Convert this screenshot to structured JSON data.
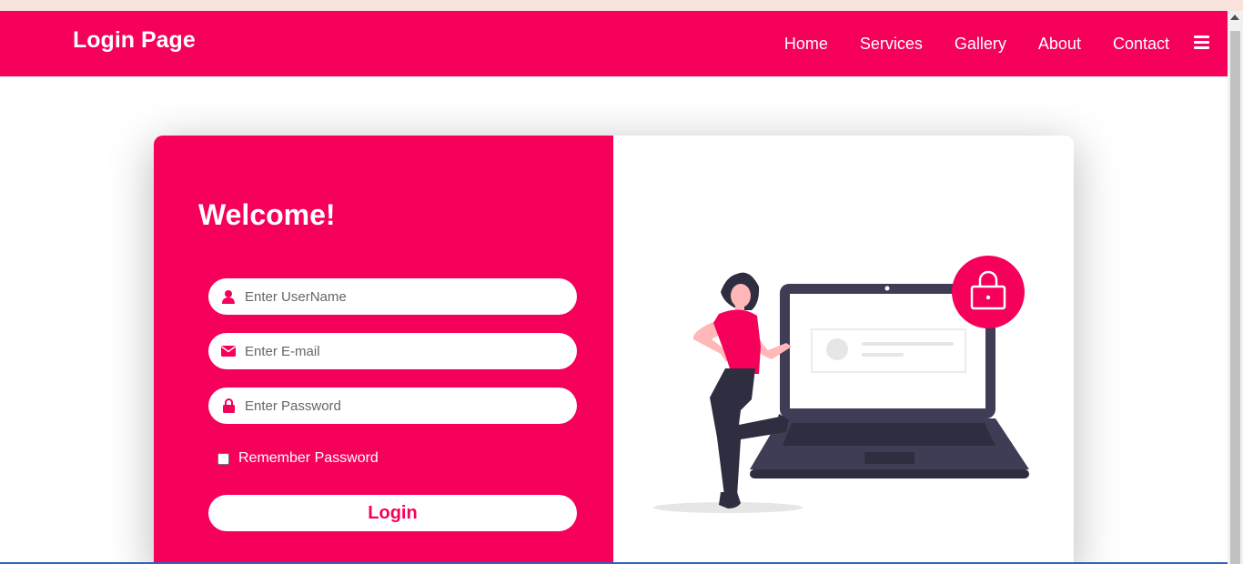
{
  "navbar": {
    "brand": "Login Page",
    "links": [
      "Home",
      "Services",
      "Gallery",
      "About",
      "Contact"
    ],
    "menu_icon": "hamburger-menu-icon"
  },
  "login": {
    "welcome": "Welcome!",
    "username_placeholder": "Enter UserName",
    "email_placeholder": "Enter E-mail",
    "password_placeholder": "Enter Password",
    "remember_label": "Remember Password",
    "remember_checked": false,
    "login_label": "Login"
  },
  "icons": {
    "username": "user-icon",
    "email": "envelope-icon",
    "password": "lock-icon"
  },
  "colors": {
    "accent": "#f5005a",
    "laptop": "#3f3d56",
    "white": "#ffffff"
  }
}
